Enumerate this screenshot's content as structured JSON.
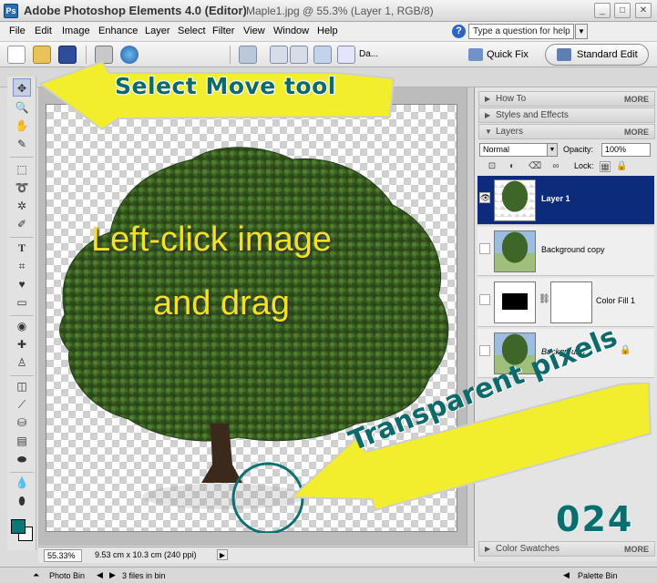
{
  "window": {
    "app_title": "Adobe Photoshop Elements 4.0 (Editor)",
    "doc_title": "Maple1.jpg @ 55.3% (Layer 1, RGB/8)",
    "minimize": "_",
    "maximize": "□",
    "close": "✕"
  },
  "menu": [
    "File",
    "Edit",
    "Image",
    "Enhance",
    "Layer",
    "Select",
    "Filter",
    "View",
    "Window",
    "Help"
  ],
  "help": {
    "placeholder": "Type a question for help",
    "icon": "?"
  },
  "toolbar": {
    "quick_fix": "Quick Fix",
    "standard_edit": "Standard Edit",
    "date_label": "Da..."
  },
  "status": {
    "zoom": "55.33%",
    "doc_size": "9.53 cm x 10.3 cm (240 ppi)"
  },
  "palette": {
    "how_to": "How To",
    "styles": "Styles and Effects",
    "layers": "Layers",
    "more": "MORE",
    "blend_mode": "Normal",
    "opacity_label": "Opacity:",
    "opacity_value": "100%",
    "lock_label": "Lock:",
    "color_swatches": "Color Swatches"
  },
  "layers": [
    {
      "name": "Layer 1",
      "selected": true
    },
    {
      "name": "Background copy",
      "selected": false
    },
    {
      "name": "Color Fill 1",
      "selected": false
    },
    {
      "name": "Background",
      "selected": false
    }
  ],
  "bottom": {
    "photo_bin": "Photo Bin",
    "files_in_bin": "3 files in bin",
    "palette_bin": "Palette Bin"
  },
  "overlay": {
    "move_tool": "Select Move tool",
    "drag_line1": "Left-click image",
    "drag_line2": "and drag",
    "transparent": "Transparent pixels",
    "episode": "024"
  },
  "colors": {
    "foreground": "#0b7777",
    "background": "#ffffff",
    "selected_layer": "#0c2b7a",
    "callout_yellow": "#f3ee2d"
  }
}
